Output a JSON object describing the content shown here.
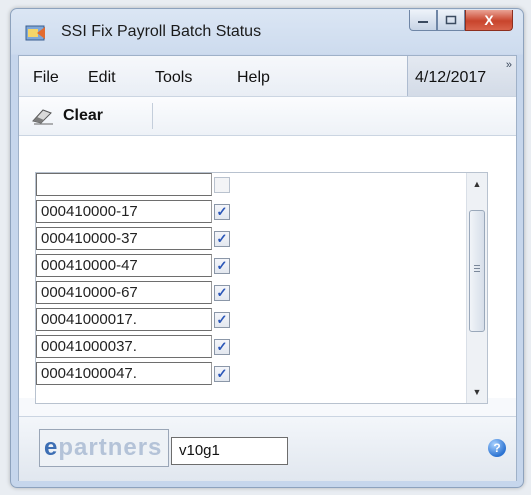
{
  "window": {
    "title": "SSI Fix Payroll Batch Status",
    "close_glyph": "X"
  },
  "menu": {
    "items": [
      "File",
      "Edit",
      "Tools",
      "Help"
    ],
    "date": "4/12/2017"
  },
  "toolbar": {
    "clear_label": "Clear",
    "clear_icon": "eraser-icon"
  },
  "grid": {
    "rows": [
      {
        "value": "",
        "checked": false
      },
      {
        "value": "000410000-17",
        "checked": true
      },
      {
        "value": "000410000-37",
        "checked": true
      },
      {
        "value": "000410000-47",
        "checked": true
      },
      {
        "value": "000410000-67",
        "checked": true
      },
      {
        "value": "00041000017.",
        "checked": true
      },
      {
        "value": "00041000037.",
        "checked": true
      },
      {
        "value": "00041000047.",
        "checked": true
      }
    ]
  },
  "footer": {
    "logo_text": "epartners",
    "version": "v10g1",
    "help_icon": "help-icon"
  },
  "colors": {
    "accent": "#3d6fb4",
    "close_button": "#c8442c"
  }
}
